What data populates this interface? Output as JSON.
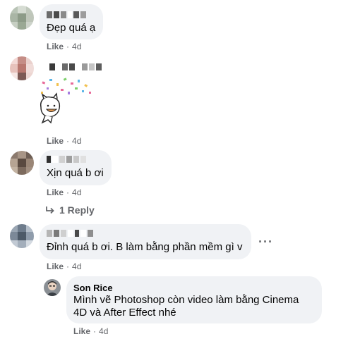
{
  "comments": [
    {
      "text": "Đẹp quá ạ",
      "like": "Like",
      "time": "4d"
    },
    {
      "like": "Like",
      "time": "4d"
    },
    {
      "text": "Xịn quá b ơi",
      "like": "Like",
      "time": "4d",
      "reply_count": "1 Reply"
    },
    {
      "text": "Đỉnh quá b ơi. B làm bằng phần mềm gì v",
      "like": "Like",
      "time": "4d",
      "more": "···"
    }
  ],
  "reply": {
    "author": "Son Rice",
    "text_line1": "Mình vẽ Photoshop còn video làm bằng Cinema",
    "text_line2": "4D và After Effect nhé",
    "like": "Like",
    "time": "4d"
  }
}
